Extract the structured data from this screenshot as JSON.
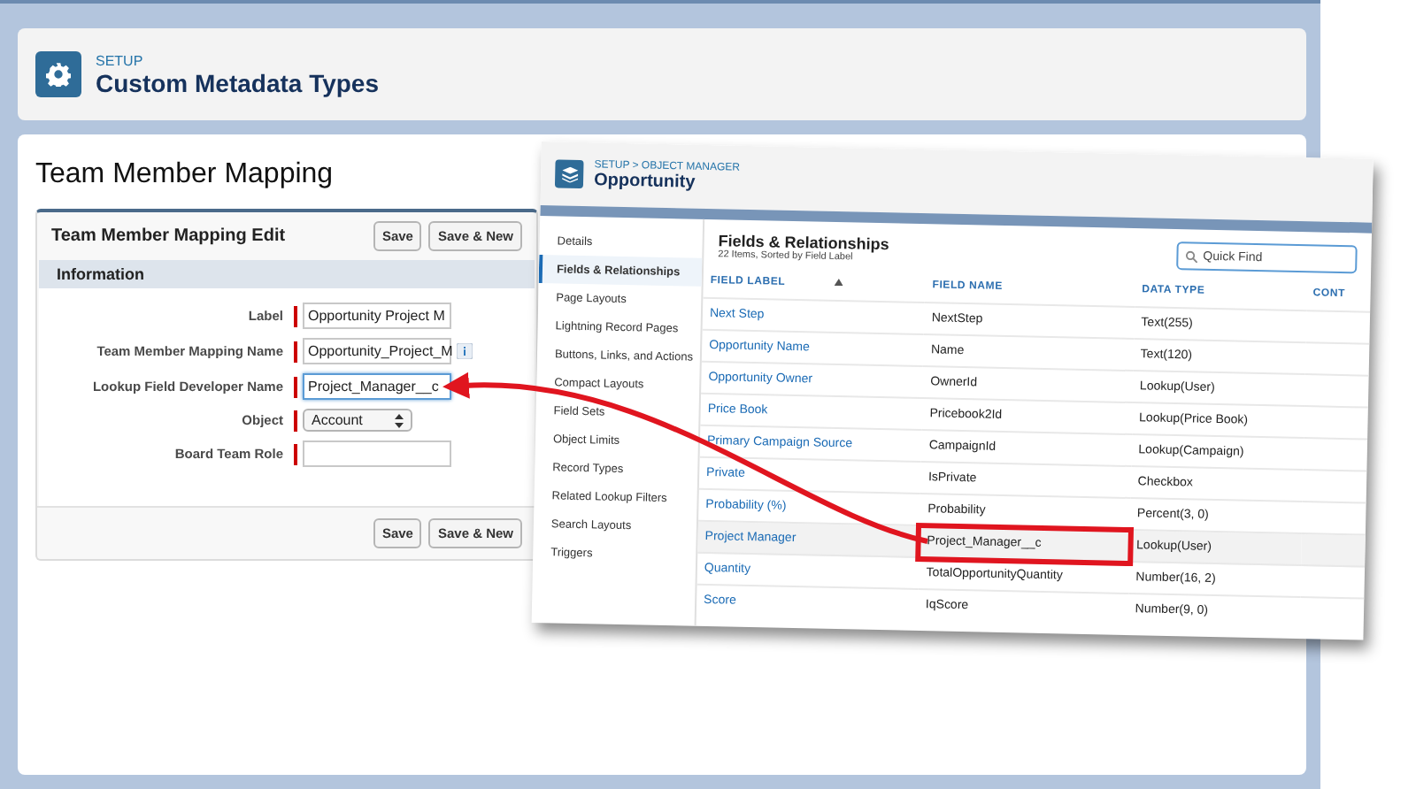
{
  "header": {
    "breadcrumb": "SETUP",
    "title": "Custom Metadata Types"
  },
  "page": {
    "title": "Team Member Mapping"
  },
  "edit_form": {
    "title": "Team Member Mapping Edit",
    "buttons_top": [
      "Save",
      "Save & New"
    ],
    "section": "Information",
    "fields": [
      {
        "label": "Label",
        "kind": "text",
        "value": "Opportunity Project M",
        "required": true,
        "focused": false,
        "info": false
      },
      {
        "label": "Team Member Mapping Name",
        "kind": "text",
        "value": "Opportunity_Project_M",
        "required": true,
        "focused": false,
        "info": true
      },
      {
        "label": "Lookup Field Developer Name",
        "kind": "text",
        "value": "Project_Manager__c",
        "required": true,
        "focused": true,
        "info": false
      },
      {
        "label": "Object",
        "kind": "select",
        "value": "Account",
        "required": true,
        "focused": false,
        "info": false
      },
      {
        "label": "Board Team Role",
        "kind": "text",
        "required": true,
        "focused": false,
        "info": false
      }
    ],
    "buttons_bottom": [
      "Save",
      "Save & New"
    ]
  },
  "object_window": {
    "breadcrumb": "SETUP > OBJECT MANAGER",
    "title": "Opportunity",
    "sidebar": [
      {
        "label": "Details",
        "selected": false
      },
      {
        "label": "Fields & Relationships",
        "selected": true
      },
      {
        "label": "Page Layouts",
        "selected": false
      },
      {
        "label": "Lightning Record Pages",
        "selected": false
      },
      {
        "label": "Buttons, Links, and Actions",
        "selected": false
      },
      {
        "label": "Compact Layouts",
        "selected": false
      },
      {
        "label": "Field Sets",
        "selected": false
      },
      {
        "label": "Object Limits",
        "selected": false
      },
      {
        "label": "Record Types",
        "selected": false
      },
      {
        "label": "Related Lookup Filters",
        "selected": false
      },
      {
        "label": "Search Layouts",
        "selected": false
      },
      {
        "label": "Triggers",
        "selected": false
      }
    ],
    "panel": {
      "title": "Fields & Relationships",
      "subtitle": "22 Items, Sorted by Field Label",
      "search": {
        "placeholder": "Quick Find"
      },
      "columns": [
        {
          "label": "FIELD LABEL",
          "sorted": true
        },
        {
          "label": "FIELD NAME",
          "sorted": false
        },
        {
          "label": "DATA TYPE",
          "sorted": false
        },
        {
          "label": "CONT",
          "sorted": false
        }
      ],
      "rows": [
        {
          "field_label": "Next Step",
          "field_name": "NextStep",
          "data_type": "Text(255)",
          "highlighted": false,
          "boxed": false
        },
        {
          "field_label": "Opportunity Name",
          "field_name": "Name",
          "data_type": "Text(120)",
          "highlighted": false,
          "boxed": false
        },
        {
          "field_label": "Opportunity Owner",
          "field_name": "OwnerId",
          "data_type": "Lookup(User)",
          "highlighted": false,
          "boxed": false
        },
        {
          "field_label": "Price Book",
          "field_name": "Pricebook2Id",
          "data_type": "Lookup(Price Book)",
          "highlighted": false,
          "boxed": false
        },
        {
          "field_label": "Primary Campaign Source",
          "field_name": "CampaignId",
          "data_type": "Lookup(Campaign)",
          "highlighted": false,
          "boxed": false
        },
        {
          "field_label": "Private",
          "field_name": "IsPrivate",
          "data_type": "Checkbox",
          "highlighted": false,
          "boxed": false
        },
        {
          "field_label": "Probability (%)",
          "field_name": "Probability",
          "data_type": "Percent(3, 0)",
          "highlighted": false,
          "boxed": false
        },
        {
          "field_label": "Project Manager",
          "field_name": "Project_Manager__c",
          "data_type": "Lookup(User)",
          "highlighted": true,
          "boxed": true
        },
        {
          "field_label": "Quantity",
          "field_name": "TotalOpportunityQuantity",
          "data_type": "Number(16, 2)",
          "highlighted": false,
          "boxed": false
        },
        {
          "field_label": "Score",
          "field_name": "IqScore",
          "data_type": "Number(9, 0)",
          "highlighted": false,
          "boxed": false
        }
      ]
    }
  }
}
